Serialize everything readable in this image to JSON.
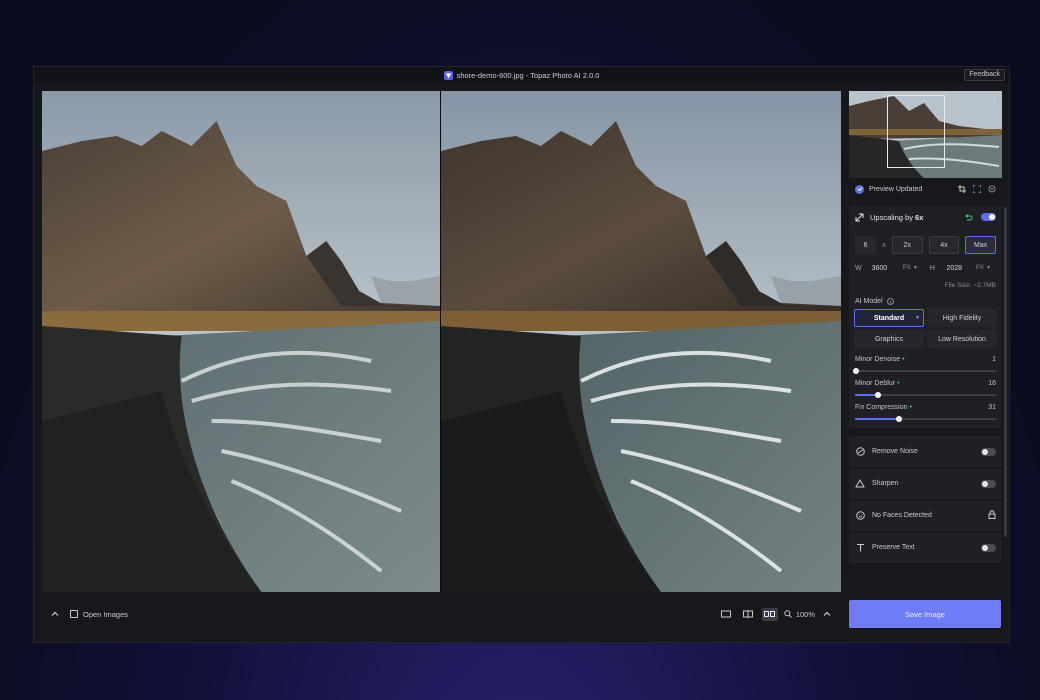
{
  "window": {
    "title": "shore-demo-600.jpg - Topaz Photo AI 2.0.0",
    "feedback_label": "Feedback"
  },
  "bottom_bar": {
    "open_images_label": "Open Images",
    "zoom_level": "100%"
  },
  "panel": {
    "preview_status": "Preview Updated",
    "upscale": {
      "label_prefix": "Upscaling by ",
      "factor_label": "6x",
      "enabled": true,
      "scale_value": "6",
      "scale_unit": "x",
      "presets": [
        "2x",
        "4x",
        "Max"
      ],
      "selected_preset": "Max",
      "width_label": "W",
      "width_value": "3600",
      "height_label": "H",
      "height_value": "2028",
      "unit": "PX",
      "file_size": "File Size: ~2.7MB"
    },
    "ai_model": {
      "label": "AI Model",
      "options": [
        "Standard",
        "High Fidelity",
        "Graphics",
        "Low Resolution"
      ],
      "selected": "Standard"
    },
    "sliders": [
      {
        "label": "Minor Denoise",
        "value": 1
      },
      {
        "label": "Minor Deblur",
        "value": 16
      },
      {
        "label": "Fix Compression",
        "value": 31
      }
    ],
    "features": [
      {
        "label": "Remove Noise",
        "enabled": false
      },
      {
        "label": "Sharpen",
        "enabled": false
      },
      {
        "label": "No Faces Detected",
        "locked": true
      },
      {
        "label": "Preserve Text",
        "enabled": false
      }
    ],
    "save_label": "Save Image"
  },
  "colors": {
    "accent": "#5b6ff6",
    "save_button": "#6e7cf7",
    "active_dot": "#36d27a"
  }
}
